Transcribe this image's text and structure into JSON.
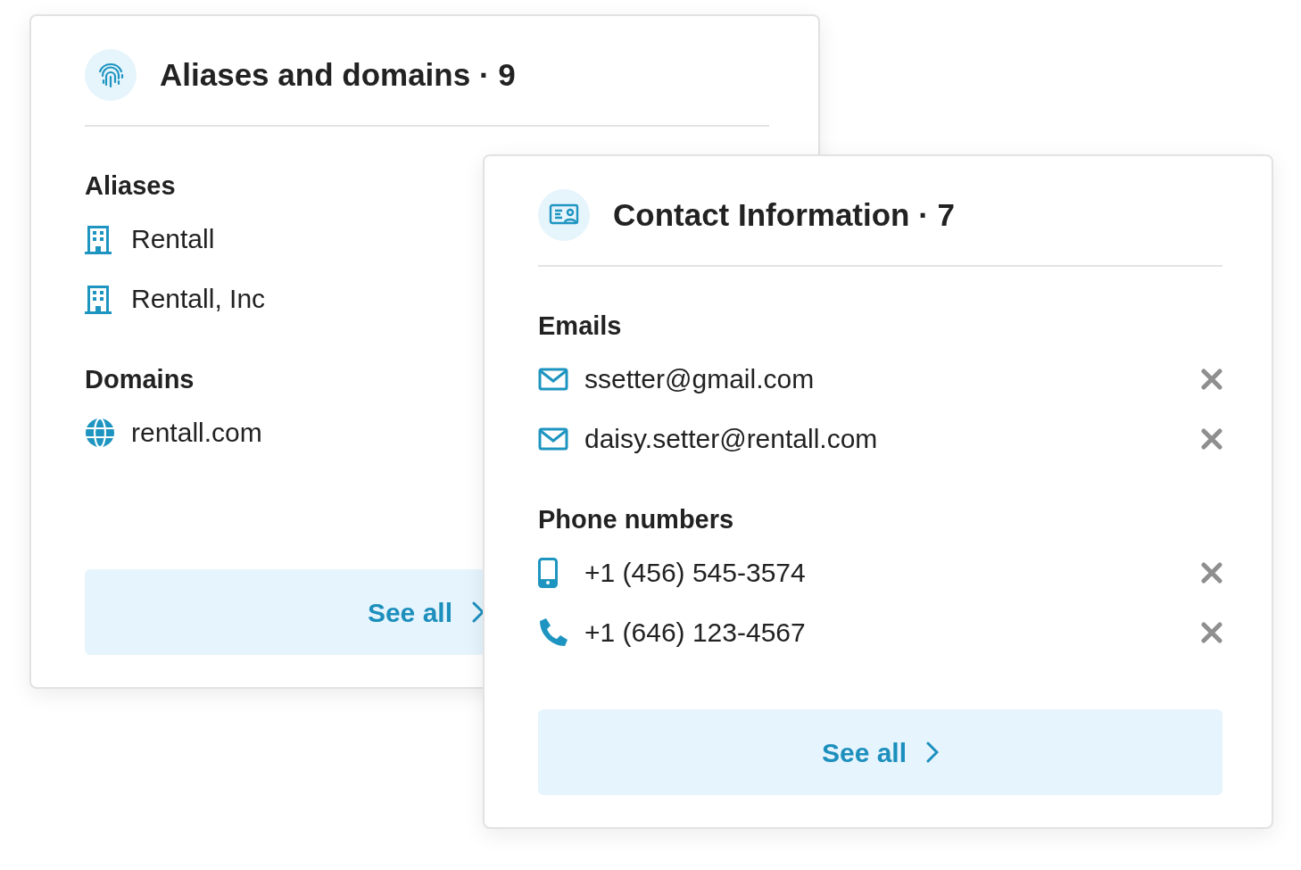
{
  "cards": [
    {
      "title": "Aliases and domains · 9",
      "kind": "fingerprint",
      "button": "See all",
      "sections": [
        {
          "heading": "Aliases",
          "items": [
            {
              "kind": "building",
              "text": "Rentall",
              "removable": false
            },
            {
              "kind": "building",
              "text": "Rentall, Inc",
              "removable": false
            }
          ]
        },
        {
          "heading": "Domains",
          "items": [
            {
              "kind": "globe",
              "text": "rentall.com",
              "removable": false
            }
          ]
        }
      ]
    },
    {
      "title": "Contact Information · 7",
      "kind": "idcard",
      "button": "See all",
      "sections": [
        {
          "heading": "Emails",
          "items": [
            {
              "kind": "envelope",
              "text": "ssetter@gmail.com",
              "removable": true
            },
            {
              "kind": "envelope",
              "text": "daisy.setter@rentall.com",
              "removable": true
            }
          ]
        },
        {
          "heading": "Phone numbers",
          "items": [
            {
              "kind": "mobile",
              "text": "+1 (456) 545-3574",
              "removable": true
            },
            {
              "kind": "phone",
              "text": "+1 (646) 123-4567",
              "removable": true
            }
          ]
        }
      ]
    }
  ]
}
